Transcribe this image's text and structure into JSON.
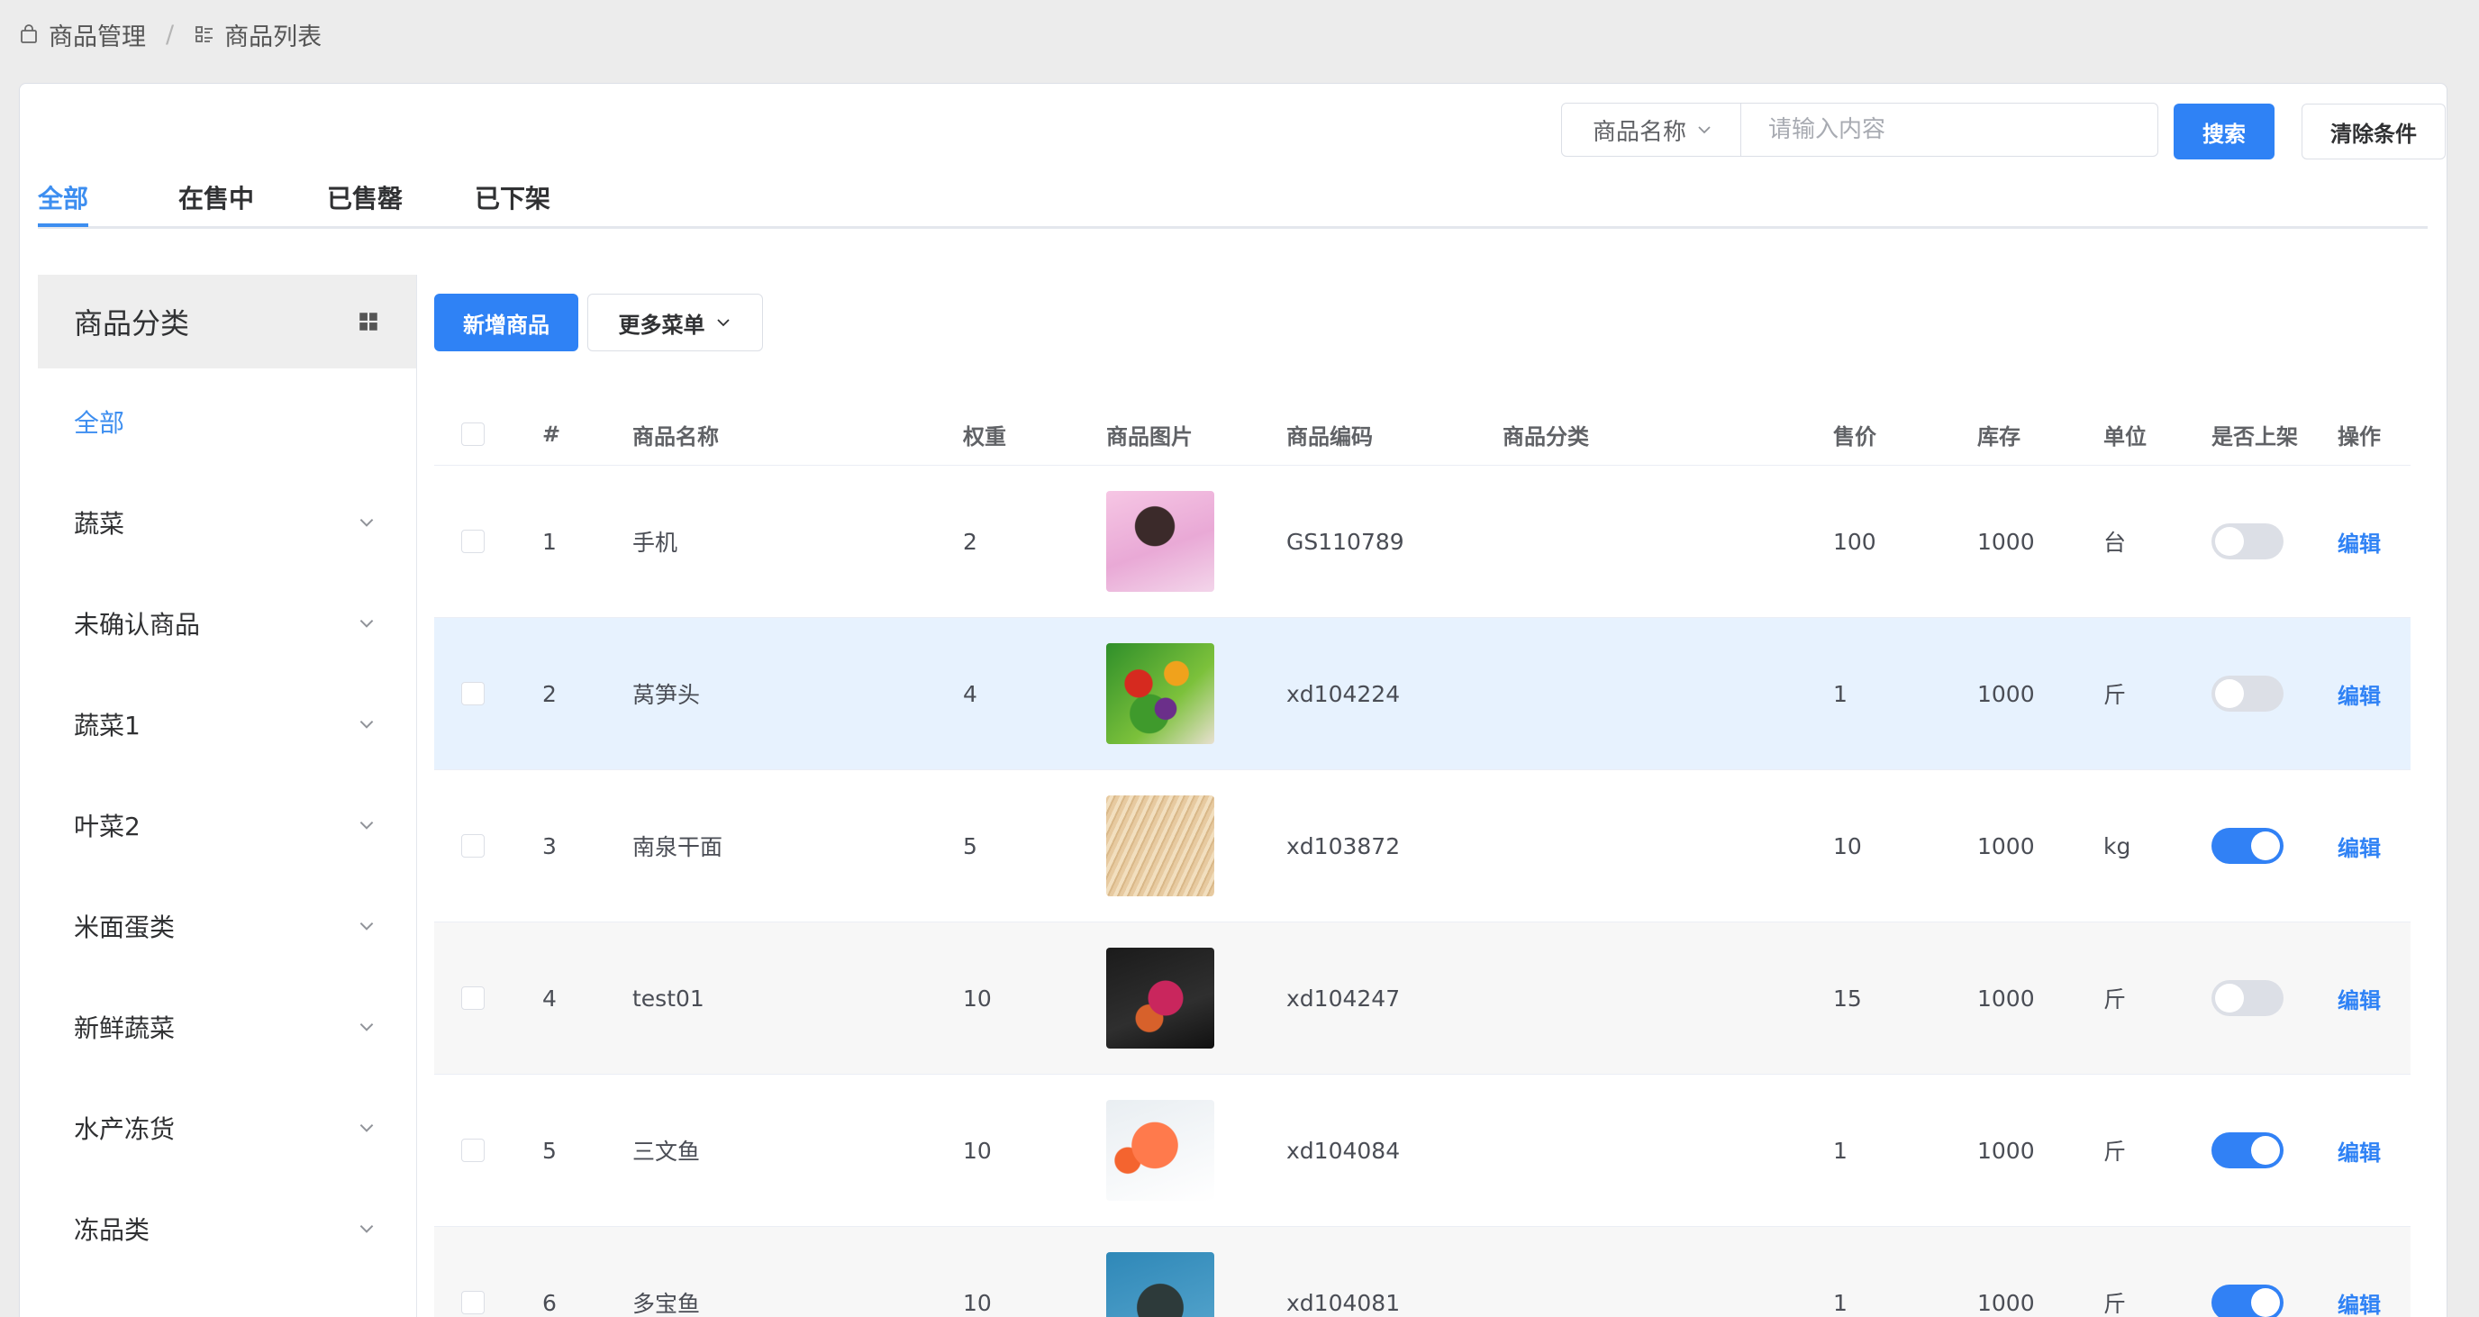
{
  "breadcrumb": {
    "parent": "商品管理",
    "current": "商品列表"
  },
  "search": {
    "field_label": "商品名称",
    "placeholder": "请输入内容",
    "search_label": "搜索",
    "clear_label": "清除条件"
  },
  "tabs": [
    "全部",
    "在售中",
    "已售罄",
    "已下架"
  ],
  "sidebar": {
    "title": "商品分类",
    "items": [
      "全部",
      "蔬菜",
      "未确认商品",
      "蔬菜1",
      "叶菜2",
      "米面蛋类",
      "新鲜蔬菜",
      "水产冻货",
      "冻品类"
    ]
  },
  "toolbar": {
    "add_label": "新增商品",
    "more_label": "更多菜单"
  },
  "table": {
    "headers": [
      "#",
      "商品名称",
      "权重",
      "商品图片",
      "商品编码",
      "商品分类",
      "售价",
      "库存",
      "单位",
      "是否上架",
      "操作"
    ],
    "rows": [
      {
        "index": "1",
        "name": "手机",
        "weight": "2",
        "image": "girl",
        "code": "GS110789",
        "category": "",
        "price": "100",
        "stock": "1000",
        "unit": "台",
        "on_sale": false,
        "action": "编辑"
      },
      {
        "index": "2",
        "name": "莴笋头",
        "weight": "4",
        "image": "vegetables",
        "code": "xd104224",
        "category": "",
        "price": "1",
        "stock": "1000",
        "unit": "斤",
        "on_sale": false,
        "action": "编辑"
      },
      {
        "index": "3",
        "name": "南泉干面",
        "weight": "5",
        "image": "noodles",
        "code": "xd103872",
        "category": "",
        "price": "10",
        "stock": "1000",
        "unit": "kg",
        "on_sale": true,
        "action": "编辑"
      },
      {
        "index": "4",
        "name": "test01",
        "weight": "10",
        "image": "snack",
        "code": "xd104247",
        "category": "",
        "price": "15",
        "stock": "1000",
        "unit": "斤",
        "on_sale": false,
        "action": "编辑"
      },
      {
        "index": "5",
        "name": "三文鱼",
        "weight": "10",
        "image": "salmon",
        "code": "xd104084",
        "category": "",
        "price": "1",
        "stock": "1000",
        "unit": "斤",
        "on_sale": true,
        "action": "编辑"
      },
      {
        "index": "6",
        "name": "多宝鱼",
        "weight": "10",
        "image": "fish",
        "code": "xd104081",
        "category": "",
        "price": "1",
        "stock": "1000",
        "unit": "斤",
        "on_sale": true,
        "action": "编辑"
      }
    ]
  },
  "colors": {
    "primary": "#2f82f5",
    "active_text": "#3d8ef0",
    "selected_row": "#e7f2fe"
  }
}
